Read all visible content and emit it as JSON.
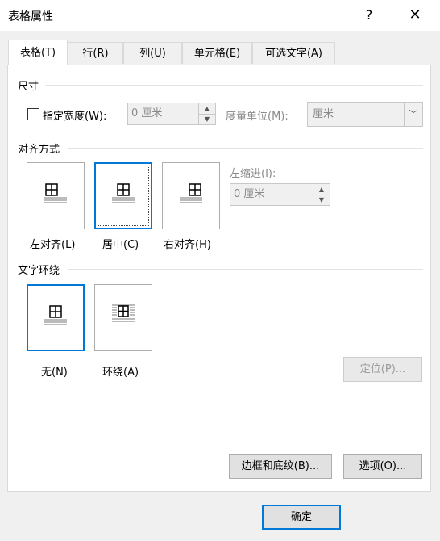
{
  "window": {
    "title": "表格属性",
    "help_icon": "?",
    "close_icon": "✕"
  },
  "tabs": [
    {
      "label": "表格(T)",
      "active": true
    },
    {
      "label": "行(R)",
      "active": false
    },
    {
      "label": "列(U)",
      "active": false
    },
    {
      "label": "单元格(E)",
      "active": false
    },
    {
      "label": "可选文字(A)",
      "active": false
    }
  ],
  "size": {
    "section_label": "尺寸",
    "preferred_width_label": "指定宽度(W):",
    "preferred_width_checked": false,
    "preferred_width_value": "0 厘米",
    "measure_in_label": "度量单位(M):",
    "measure_in_value": "厘米"
  },
  "alignment": {
    "section_label": "对齐方式",
    "options": [
      {
        "label": "左对齐(L)",
        "selected": false
      },
      {
        "label": "居中(C)",
        "selected": true
      },
      {
        "label": "右对齐(H)",
        "selected": false
      }
    ],
    "indent_label": "左缩进(I):",
    "indent_value": "0 厘米"
  },
  "text_wrapping": {
    "section_label": "文字环绕",
    "options": [
      {
        "label": "无(N)",
        "selected": true
      },
      {
        "label": "环绕(A)",
        "selected": false
      }
    ],
    "positioning_button": "定位(P)..."
  },
  "buttons": {
    "borders_shading": "边框和底纹(B)...",
    "options": "选项(O)...",
    "ok": "确定"
  }
}
